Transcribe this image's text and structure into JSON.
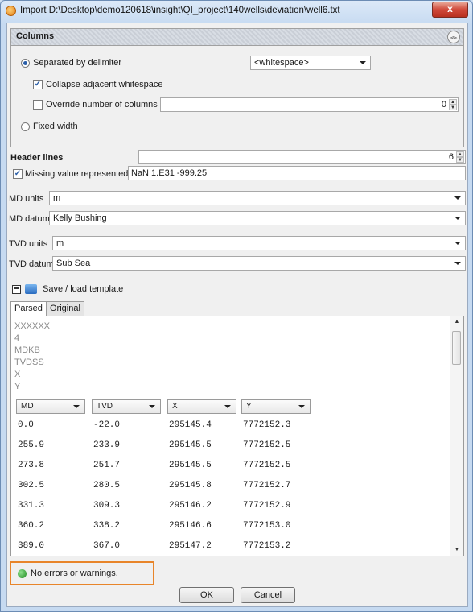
{
  "window": {
    "title": "Import D:\\Desktop\\demo120618\\insight\\QI_project\\140wells\\deviation\\well6.txt",
    "close_label": "x"
  },
  "columns": {
    "title": "Columns",
    "separated_label": "Separated by delimiter",
    "delimiter_value": "<whitespace>",
    "collapse_label": "Collapse adjacent whitespace",
    "collapse_checked": true,
    "override_label": "Override number of columns",
    "override_checked": false,
    "override_value": "0",
    "fixed_width_label": "Fixed width",
    "mode": "separated"
  },
  "header_lines": {
    "label": "Header lines",
    "value": "6"
  },
  "missing": {
    "label": "Missing value represented by",
    "checked": true,
    "value": "NaN 1.E31 -999.25"
  },
  "md_units": {
    "label": "MD units",
    "value": "m"
  },
  "md_datum": {
    "label": "MD datum",
    "value": "Kelly Bushing"
  },
  "tvd_units": {
    "label": "TVD units",
    "value": "m"
  },
  "tvd_datum": {
    "label": "TVD datum",
    "value": "Sub Sea"
  },
  "template": {
    "label": "Save / load template"
  },
  "tabs": [
    "Parsed",
    "Original"
  ],
  "header_preview": [
    "XXXXXX",
    "4",
    "MDKB",
    "TVDSS",
    "X",
    "Y"
  ],
  "column_headers": [
    "MD",
    "TVD",
    "X",
    "Y"
  ],
  "rows": [
    [
      "0.0",
      "-22.0",
      "295145.4",
      "7772152.3"
    ],
    [
      "255.9",
      "233.9",
      "295145.5",
      "7772152.5"
    ],
    [
      "273.8",
      "251.7",
      "295145.5",
      "7772152.5"
    ],
    [
      "302.5",
      "280.5",
      "295145.8",
      "7772152.7"
    ],
    [
      "331.3",
      "309.3",
      "295146.2",
      "7772152.9"
    ],
    [
      "360.2",
      "338.2",
      "295146.6",
      "7772153.0"
    ],
    [
      "389.0",
      "367.0",
      "295147.2",
      "7772153.2"
    ]
  ],
  "status": {
    "text": "No errors or warnings.",
    "color": "#22a022"
  },
  "buttons": {
    "ok": "OK",
    "cancel": "Cancel"
  },
  "colors": {
    "accent": "#2a5ea8",
    "highlight": "#e8852a",
    "close": "#c8402f"
  }
}
